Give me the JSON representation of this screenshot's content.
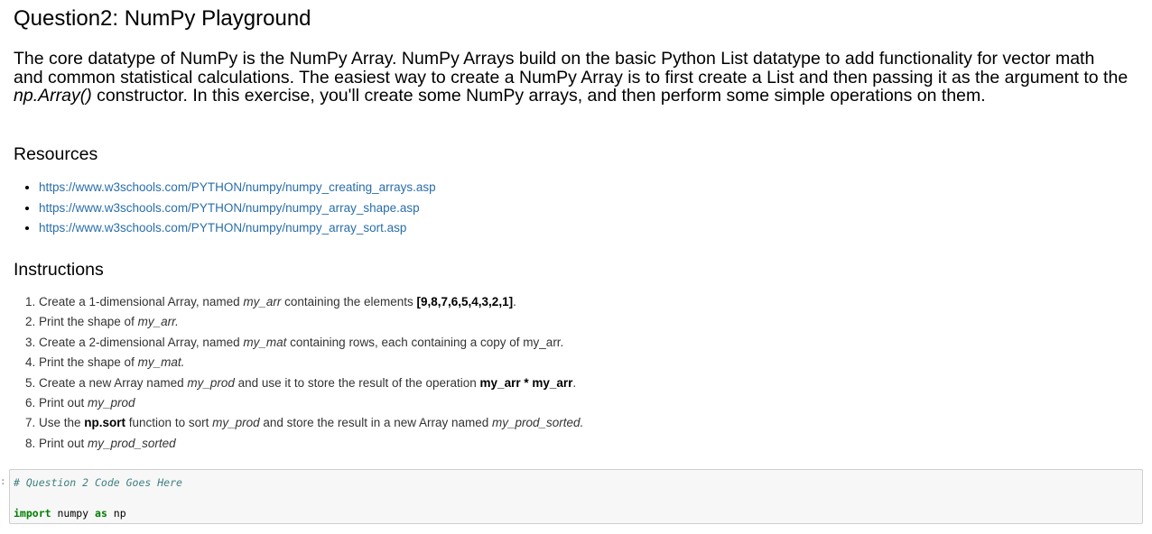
{
  "title": "Question2: NumPy Playground",
  "intro": {
    "p1": "The core datatype of NumPy is the NumPy Array. NumPy Arrays build on the basic Python List datatype to add functionality for vector math and common statistical calculations. The easiest way to create a NumPy Array is to first create a List and then passing it as the argument to the ",
    "code": "np.Array()",
    "p2": " constructor. In this exercise, you'll create some NumPy arrays, and then perform some simple operations on them."
  },
  "resources": {
    "heading": "Resources",
    "links": [
      "https://www.w3schools.com/PYTHON/numpy/numpy_creating_arrays.asp",
      "https://www.w3schools.com/PYTHON/numpy/numpy_array_shape.asp",
      "https://www.w3schools.com/PYTHON/numpy/numpy_array_sort.asp"
    ]
  },
  "instructions": {
    "heading": "Instructions",
    "s1a": "Create a 1-dimensional Array, named ",
    "s1b": "my_arr",
    "s1c": " containing the elements ",
    "s1d": "[9,8,7,6,5,4,3,2,1]",
    "s1e": ".",
    "s2a": "Print the shape of ",
    "s2b": "my_arr.",
    "s3a": "Create a 2-dimensional Array, named ",
    "s3b": "my_mat",
    "s3c": " containing rows, each containing a copy of my_arr.",
    "s4a": "Print the shape of ",
    "s4b": "my_mat.",
    "s5a": "Create a new Array named ",
    "s5b": "my_prod",
    "s5c": " and use it to store the result of the operation ",
    "s5d": "my_arr * my_arr",
    "s5e": ".",
    "s6a": "Print out ",
    "s6b": "my_prod",
    "s7a": "Use the ",
    "s7b": "np.sort",
    "s7c": " function to sort ",
    "s7d": "my_prod",
    "s7e": " and store the result in a new Array named ",
    "s7f": "my_prod_sorted.",
    "s8a": "Print out ",
    "s8b": "my_prod_sorted"
  },
  "code_cell": {
    "prompt": ":",
    "comment": "# Question 2 Code Goes Here",
    "kw_import": "import",
    "module": " numpy ",
    "kw_as": "as",
    "alias": " np"
  }
}
